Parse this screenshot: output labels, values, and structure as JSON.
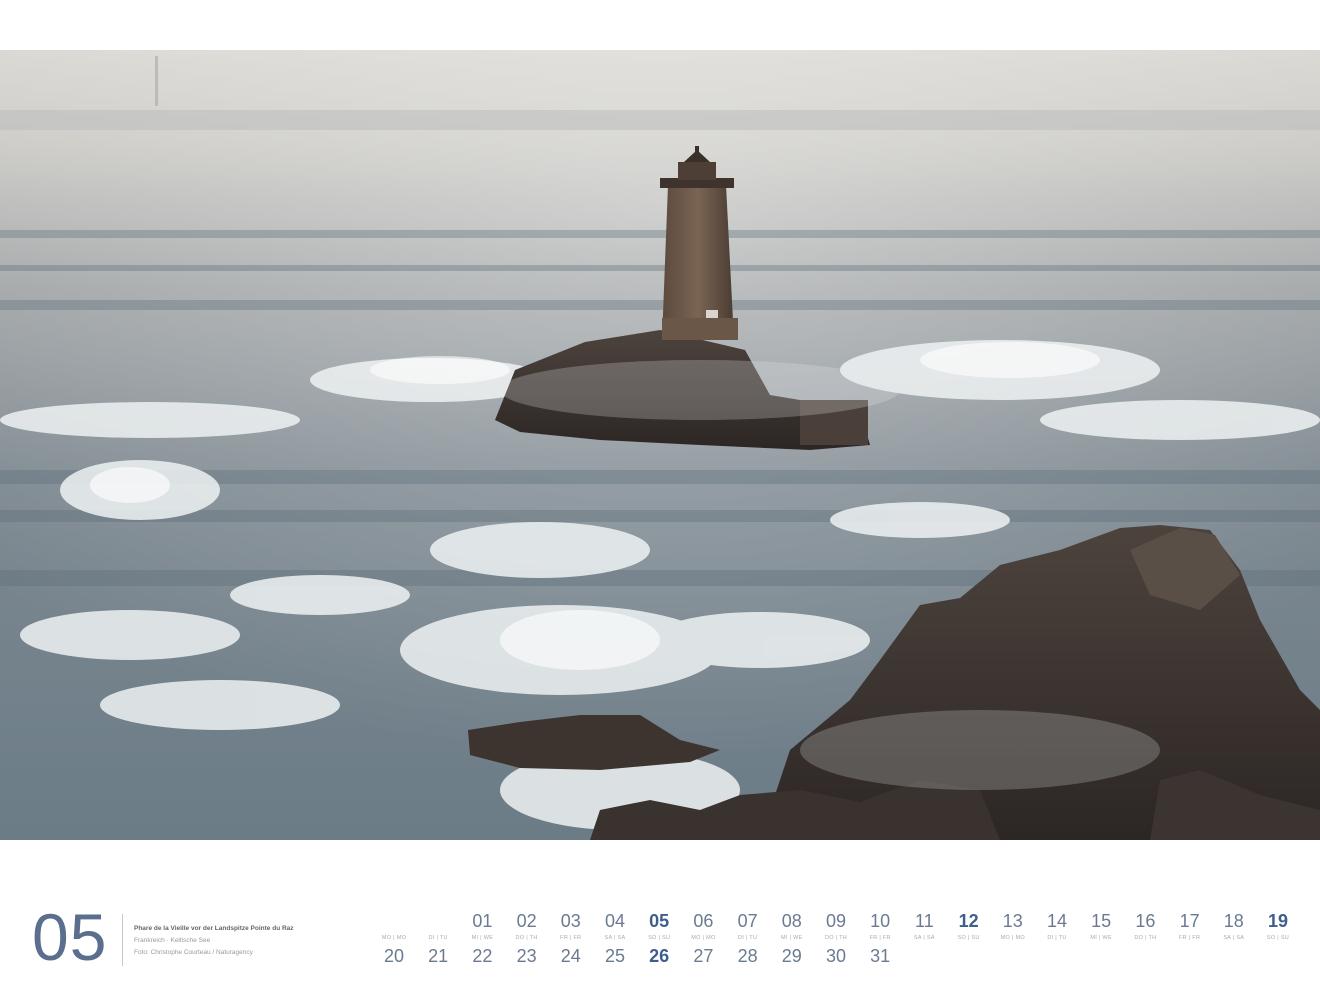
{
  "month": {
    "number": "05"
  },
  "caption": {
    "title": "Phare de la Vieille vor der Landspitze Pointe du Raz",
    "location": "Frankreich · Keltische See",
    "credit": "Foto: Christophe Courteau / Naturagency"
  },
  "colors": {
    "month_number": "#5a6f8d",
    "day_number": "#6b7a92",
    "sunday": "#3e5e8c",
    "weekday_label": "#a9a9a9"
  },
  "calendar": {
    "row1": [
      {
        "num": "01",
        "wd": "MI | WE",
        "sunday": false
      },
      {
        "num": "02",
        "wd": "DO | TH",
        "sunday": false
      },
      {
        "num": "03",
        "wd": "FR | FR",
        "sunday": false
      },
      {
        "num": "04",
        "wd": "SA | SA",
        "sunday": false
      },
      {
        "num": "05",
        "wd": "SO | SU",
        "sunday": true
      },
      {
        "num": "06",
        "wd": "MO | MO",
        "sunday": false
      },
      {
        "num": "07",
        "wd": "DI | TU",
        "sunday": false
      },
      {
        "num": "08",
        "wd": "MI | WE",
        "sunday": false
      },
      {
        "num": "09",
        "wd": "DO | TH",
        "sunday": false
      },
      {
        "num": "10",
        "wd": "FR | FR",
        "sunday": false
      },
      {
        "num": "11",
        "wd": "SA | SA",
        "sunday": false
      },
      {
        "num": "12",
        "wd": "SO | SU",
        "sunday": true
      },
      {
        "num": "13",
        "wd": "MO | MO",
        "sunday": false
      },
      {
        "num": "14",
        "wd": "DI | TU",
        "sunday": false
      },
      {
        "num": "15",
        "wd": "MI | WE",
        "sunday": false
      },
      {
        "num": "16",
        "wd": "DO | TH",
        "sunday": false
      },
      {
        "num": "17",
        "wd": "FR | FR",
        "sunday": false
      },
      {
        "num": "18",
        "wd": "SA | SA",
        "sunday": false
      },
      {
        "num": "19",
        "wd": "SO | SU",
        "sunday": true
      }
    ],
    "row2": [
      {
        "num": "20",
        "wd": "MO | MO",
        "sunday": false
      },
      {
        "num": "21",
        "wd": "DI | TU",
        "sunday": false
      },
      {
        "num": "22",
        "wd": "",
        "sunday": false
      },
      {
        "num": "23",
        "wd": "",
        "sunday": false
      },
      {
        "num": "24",
        "wd": "",
        "sunday": false
      },
      {
        "num": "25",
        "wd": "",
        "sunday": false
      },
      {
        "num": "26",
        "wd": "",
        "sunday": true
      },
      {
        "num": "27",
        "wd": "",
        "sunday": false
      },
      {
        "num": "28",
        "wd": "",
        "sunday": false
      },
      {
        "num": "29",
        "wd": "",
        "sunday": false
      },
      {
        "num": "30",
        "wd": "",
        "sunday": false
      },
      {
        "num": "31",
        "wd": "",
        "sunday": false
      }
    ]
  }
}
